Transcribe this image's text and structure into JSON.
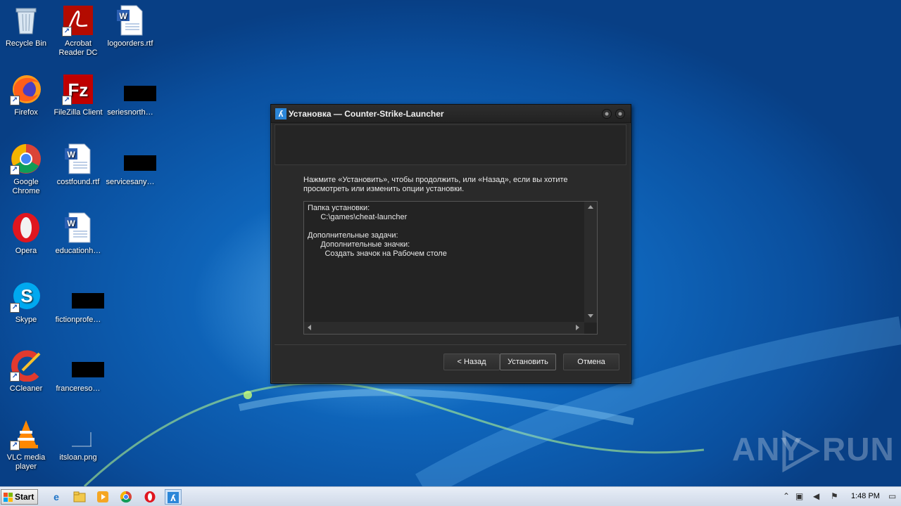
{
  "desktop": {
    "icons": [
      {
        "label": "Recycle Bin",
        "icon": "recycle-bin-icon"
      },
      {
        "label": "Acrobat Reader DC",
        "icon": "acrobat-icon"
      },
      {
        "label": "logoorders.rtf",
        "icon": "word-doc-icon"
      },
      {
        "label": "Firefox",
        "icon": "firefox-icon"
      },
      {
        "label": "FileZilla Client",
        "icon": "filezilla-icon"
      },
      {
        "label": "seriesnorth…",
        "icon": "redacted-icon"
      },
      {
        "label": "Google Chrome",
        "icon": "chrome-icon"
      },
      {
        "label": "costfound.rtf",
        "icon": "word-doc-icon"
      },
      {
        "label": "servicesany…",
        "icon": "redacted-icon"
      },
      {
        "label": "Opera",
        "icon": "opera-icon"
      },
      {
        "label": "educationh…",
        "icon": "word-doc-icon"
      },
      {
        "label": "Skype",
        "icon": "skype-icon"
      },
      {
        "label": "fictionprofe…",
        "icon": "redacted-icon"
      },
      {
        "label": "CCleaner",
        "icon": "ccleaner-icon"
      },
      {
        "label": "francereso…",
        "icon": "redacted-icon"
      },
      {
        "label": "VLC media player",
        "icon": "vlc-icon"
      },
      {
        "label": "itsloan.png",
        "icon": "image-file-icon"
      }
    ]
  },
  "dialog": {
    "title": "Установка — Counter-Strike-Launcher",
    "instructions": "Нажмите «Установить», чтобы продолжить, или «Назад», если вы хотите просмотреть или изменить опции установки.",
    "summary": {
      "install_folder_label": "Папка установки:",
      "install_folder_value": "C:\\games\\cheat-launcher",
      "tasks_label": "Дополнительные задачи:",
      "icons_label": "Дополнительные значки:",
      "desktop_icon_task": "Создать значок на Рабочем столе"
    },
    "buttons": {
      "back": "< Назад",
      "install": "Установить",
      "cancel": "Отмена"
    }
  },
  "taskbar": {
    "start_label": "Start",
    "time": "1:48 PM"
  },
  "watermark": {
    "left": "ANY",
    "right": "RUN"
  }
}
